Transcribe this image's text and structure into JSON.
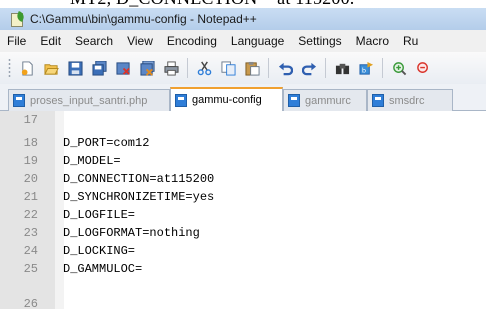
{
  "cut_caption": "MT2, D_CONNECTION = at 115200.",
  "window": {
    "title": "C:\\Gammu\\bin\\gammu-config - Notepad++"
  },
  "menu": [
    "File",
    "Edit",
    "Search",
    "View",
    "Encoding",
    "Language",
    "Settings",
    "Macro",
    "Ru"
  ],
  "toolbar_icons": [
    "new-file-icon",
    "open-file-icon",
    "save-icon",
    "save-all-icon",
    "close-icon",
    "close-all-icon",
    "print-icon",
    "cut-icon",
    "copy-icon",
    "paste-icon",
    "undo-icon",
    "redo-icon",
    "find-icon",
    "replace-icon",
    "zoom-in-icon",
    "zoom-out-icon"
  ],
  "tabs": [
    {
      "label": "proses_input_santri.php",
      "active": false
    },
    {
      "label": "gammu-config",
      "active": true
    },
    {
      "label": "gammurc",
      "active": false
    },
    {
      "label": "smsdrc",
      "active": false
    }
  ],
  "editor": {
    "lines": [
      {
        "num": "17",
        "text": ""
      },
      {
        "num": "18",
        "text": "D_PORT=com12"
      },
      {
        "num": "19",
        "text": "D_MODEL="
      },
      {
        "num": "20",
        "text": "D_CONNECTION=at115200"
      },
      {
        "num": "21",
        "text": "D_SYNCHRONIZETIME=yes"
      },
      {
        "num": "22",
        "text": "D_LOGFILE="
      },
      {
        "num": "23",
        "text": "D_LOGFORMAT=nothing"
      },
      {
        "num": "24",
        "text": "D_LOCKING="
      },
      {
        "num": "25",
        "text": "D_GAMMULOC="
      },
      {
        "num": "26",
        "text": ""
      }
    ]
  },
  "colors": {
    "titlebar": "#c9ddf3",
    "tab_accent": "#f0a030",
    "file_icon": "#2f7ed8"
  }
}
